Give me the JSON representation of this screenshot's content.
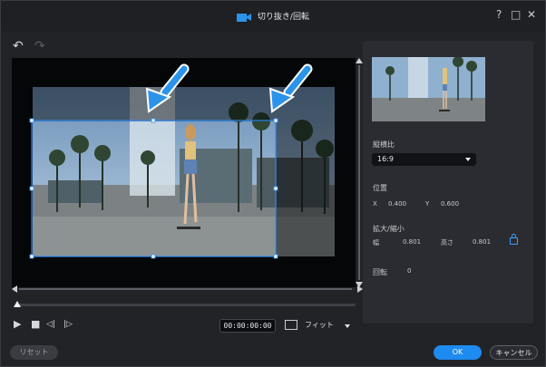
{
  "title": "切り抜き/回転",
  "window_controls": {
    "help": "?",
    "maximize": "□",
    "close": "✕"
  },
  "toolbar": {
    "undo": "↶",
    "redo": "↷"
  },
  "player": {
    "timecode": "00:00:00:00",
    "fit_label": "フィット",
    "play": "▶",
    "stop": "■",
    "prev_frame": "◁|",
    "next_frame": "|▷"
  },
  "panel": {
    "aspect_label": "縦横比",
    "aspect_value": "16:9",
    "position_label": "位置",
    "x_label": "X",
    "x_value": "0.400",
    "y_label": "Y",
    "y_value": "0.600",
    "scale_label": "拡大/縮小",
    "width_label": "幅",
    "width_value": "0.801",
    "height_label": "高さ",
    "height_value": "0.801",
    "rotate_label": "回転",
    "rotate_value": "0"
  },
  "footer": {
    "reset": "リセット",
    "ok": "OK",
    "cancel": "キャンセル"
  },
  "colors": {
    "accent": "#1e8bf0",
    "crop_border": "#2f8ef5",
    "arrow": "#2b93ea"
  }
}
